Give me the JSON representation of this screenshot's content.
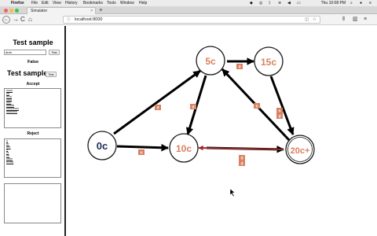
{
  "menubar": {
    "apple": "",
    "items": [
      "Firefox",
      "File",
      "Edit",
      "View",
      "History",
      "Bookmarks",
      "Tools",
      "Window",
      "Help"
    ],
    "clock": "Thu 10:08 PM"
  },
  "tab": {
    "title": "Simulator",
    "close": "×"
  },
  "newtab": "+",
  "nav": {
    "back": "←",
    "forward": "→",
    "reload": "C",
    "home": "⌂",
    "url": "localhost:8000"
  },
  "panel": {
    "title": "Test sample",
    "input_value": "drdn",
    "test_label": "Test",
    "result": "False",
    "title2": "Test sample",
    "test_label2": "Test",
    "accept_label": "Accept",
    "accept_items": [
      "uuuu",
      "dd",
      "rrrrd",
      "rudu",
      "drrn",
      "ddddd",
      "nnnnnnnn",
      "dddnnnn"
    ],
    "reject_label": "Reject",
    "reject_items": [
      "u",
      "rrr",
      "nrrr",
      "d",
      "rd",
      "nn",
      "uddn",
      "rrrrrrd"
    ]
  },
  "graph": {
    "colors": {
      "node_stroke": "#1a1a1a",
      "node_text": "#d9805f",
      "start_text": "#1d2c55",
      "edge": "#000000",
      "label_bg": "#d9805f",
      "highlight_arrow": "#9b2a2a"
    },
    "nodes": [
      {
        "id": "n0c",
        "label": "0c",
        "start": true
      },
      {
        "id": "n5c",
        "label": "5c"
      },
      {
        "id": "n15c",
        "label": "15c"
      },
      {
        "id": "n10c",
        "label": "10c"
      },
      {
        "id": "n20c",
        "label": "20c+",
        "accept": true
      }
    ],
    "edge_labels": [
      "d",
      "n",
      "d",
      "d",
      "n",
      "n",
      "d",
      "d",
      "d",
      "d"
    ]
  }
}
